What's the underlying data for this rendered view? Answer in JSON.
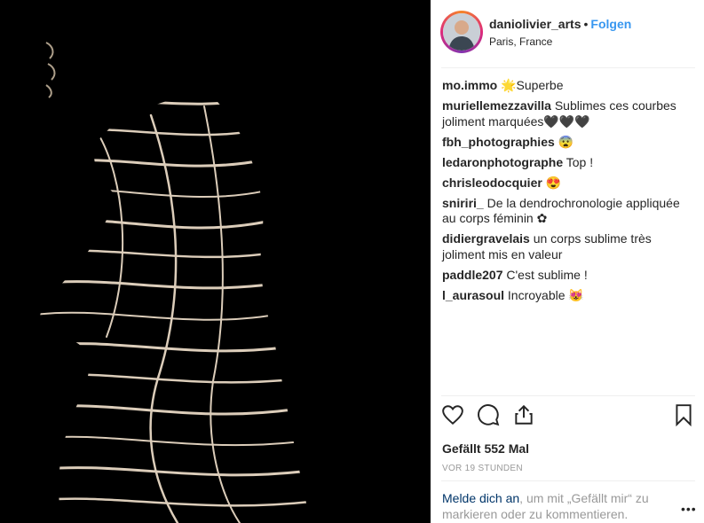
{
  "post": {
    "username": "daniolivier_arts",
    "separator": "•",
    "follow_label": "Folgen",
    "location": "Paris, France"
  },
  "comments": [
    {
      "user": "mo.immo",
      "text": "🌟Superbe"
    },
    {
      "user": "muriellemezzavilla",
      "text": "Sublimes ces courbes joliment marquées🖤🖤🖤"
    },
    {
      "user": "fbh_photographies",
      "text": "😨"
    },
    {
      "user": "ledaronphotographe",
      "text": "Top !"
    },
    {
      "user": "chrisleodocquier",
      "text": "😍"
    },
    {
      "user": "sniriri_",
      "text": "De la dendrochronologie appliquée au corps féminin ✿"
    },
    {
      "user": "didiergravelais",
      "text": "un corps sublime très joliment mis en valeur"
    },
    {
      "user": "paddle207",
      "text": "C'est sublime !"
    },
    {
      "user": "l_aurasoul",
      "text": "Incroyable 😻"
    }
  ],
  "actions": {
    "like_icon": "heart-icon",
    "comment_icon": "comment-bubble-icon",
    "share_icon": "share-icon",
    "save_icon": "bookmark-icon"
  },
  "likes": {
    "label": "Gefällt 552 Mal"
  },
  "timestamp": "VOR 19 STUNDEN",
  "login_prompt": {
    "link": "Melde dich an",
    "rest": ", um mit „Gefällt mir“ zu markieren oder zu kommentieren.",
    "more": "•••"
  },
  "colors": {
    "accent": "#3897f0",
    "photo_background": "#000000",
    "muted_text": "#999999"
  }
}
